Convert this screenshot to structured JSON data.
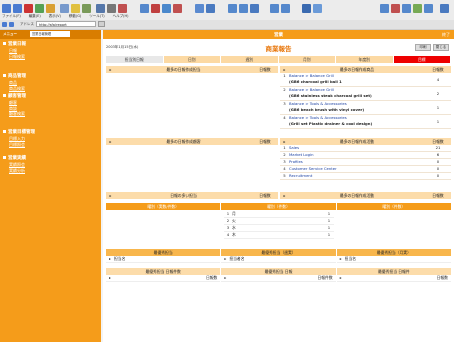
{
  "toolbar": {
    "menu": [
      "ファイル(F)",
      "編集(E)",
      "表示(V)",
      "移動(G)",
      "ツール(T)",
      "ヘルプ(H)"
    ],
    "address_label": "アドレス",
    "address_value": "http://sfa/report"
  },
  "sidebar": {
    "top_label": "メニュー",
    "select_value": "営業日報管理",
    "groups": [
      {
        "title": "営業日報",
        "items": [
          "日報",
          "日報検索"
        ]
      },
      {
        "title": "商品管理",
        "items": [
          "商品",
          "商品検索"
        ]
      },
      {
        "title": "顧客管理",
        "items": [
          "顧客",
          "商談",
          "顧客検索"
        ]
      },
      {
        "title": "営業目標管理",
        "items": [
          "目標入力",
          "目標照会"
        ]
      },
      {
        "title": "営業実績",
        "items": [
          "実績照会",
          "実績分析"
        ]
      }
    ]
  },
  "header": {
    "title": "営業",
    "right": "終了"
  },
  "report": {
    "date": "2003年1月15日(水)",
    "title": "商業報告",
    "btn_print": "印刷",
    "btn_close": "閉じる"
  },
  "tabs": [
    "担当別日報",
    "日別",
    "週別",
    "月別",
    "年度別",
    "目標"
  ],
  "panel_left1": {
    "title": "最多の日報作成担当",
    "count_label": "日報数"
  },
  "panel_right1": {
    "title": "最多の日報作成商品",
    "count_label": "日報数",
    "rows": [
      {
        "num": "1",
        "line1": "Balance > Balance Grill",
        "line2": "(GB6 charcoal grill ball 1",
        "val": "4"
      },
      {
        "num": "2",
        "line1": "Balance > Balance Grill",
        "line2": "(GB6 stainless steak charcoal grill set)",
        "val": "2"
      },
      {
        "num": "3",
        "line1": "Balance > Tools & Accessories",
        "line2": "(GB6 beach brush with vinyl cover)",
        "val": "1"
      },
      {
        "num": "4",
        "line1": "Balance > Tools & Accessories",
        "line2": "(Grill set Plastic drainer & cool design)",
        "val": "1"
      }
    ]
  },
  "panel_left2": {
    "title": "最多の日報作成顧客",
    "count_label": "日報数"
  },
  "panel_right2": {
    "title": "最多の日報作成活動",
    "count_label": "日報数",
    "rows": [
      {
        "num": "1",
        "text": "Sales",
        "val": "21"
      },
      {
        "num": "2",
        "text": "Market Login",
        "val": "6"
      },
      {
        "num": "3",
        "text": "Profiles",
        "val": "0"
      },
      {
        "num": "4",
        "text": "Customer Service Center",
        "val": "0"
      },
      {
        "num": "5",
        "text": "Recruitment",
        "val": "0"
      }
    ]
  },
  "panel_left3": {
    "title": "日報の多い担当",
    "count_label": "日報数"
  },
  "panel_right3": {
    "title": "最多の日報作成活動",
    "count_label": "日報数"
  },
  "middle_grid": {
    "heads": [
      "曜別（実数/件数）",
      "曜別（件数）",
      "曜別（件数）"
    ],
    "rows": [
      {
        "num": "1",
        "text": "月",
        "val": "1"
      },
      {
        "num": "2",
        "text": "火",
        "val": "1"
      },
      {
        "num": "3",
        "text": "水",
        "val": "1"
      },
      {
        "num": "4",
        "text": "木",
        "val": "1"
      }
    ]
  },
  "bottom": {
    "heads": [
      "最優秀担当",
      "最優秀担当（週実）",
      "最優秀担当（月実）"
    ],
    "cols": [
      "担当名",
      "担当者名",
      "担当名"
    ],
    "heads2": [
      "最優秀担当 日報件数",
      "最優秀担当 日報",
      "最優秀担当 日報件"
    ],
    "cols2": [
      "日報数",
      "日報件数",
      "日報数"
    ]
  },
  "colors": {
    "accent": "#f59c1a",
    "header_dark": "#d97d00",
    "panel_head": "#fcdcaa",
    "alert": "#ee0000"
  }
}
